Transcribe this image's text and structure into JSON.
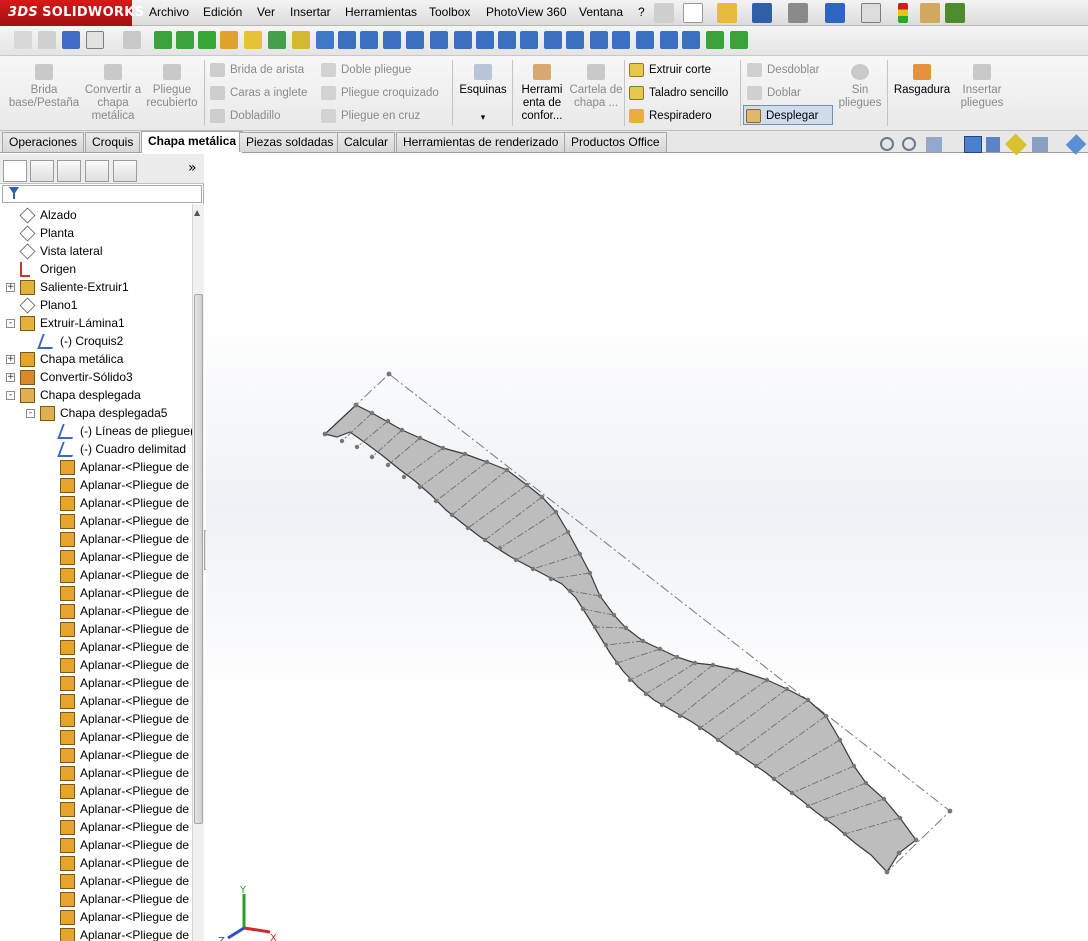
{
  "app": {
    "brand_prefix": "3DS",
    "brand": "SOLIDWORKS"
  },
  "menu": [
    "Archivo",
    "Edición",
    "Ver",
    "Insertar",
    "Herramientas",
    "Toolbox",
    "PhotoView 360",
    "Ventana",
    "?"
  ],
  "command_manager": {
    "brida_base": "Brida base/Pestaña",
    "convertir_chapa": "Convertir a chapa metálica",
    "pliegue_recubierto": "Pliegue recubierto",
    "brida_arista": "Brida de arista",
    "caras_inglete": "Caras a inglete",
    "dobladillo": "Dobladillo",
    "doble_pliegue": "Doble pliegue",
    "pliegue_croquizado": "Pliegue croquizado",
    "pliegue_cruz": "Pliegue en cruz",
    "esquinas": "Esquinas",
    "herramienta_conformar": "Herrami enta de confor...",
    "cartela": "Cartela de chapa ...",
    "extruir_corte": "Extruir corte",
    "taladro_sencillo": "Taladro sencillo",
    "respiradero": "Respiradero",
    "desdoblar": "Desdoblar",
    "doblar": "Doblar",
    "desplegar": "Desplegar",
    "sin_pliegues": "Sin pliegues",
    "rasgadura": "Rasgadura",
    "insertar_pliegues": "Insertar pliegues"
  },
  "tabs": [
    "Operaciones",
    "Croquis",
    "Chapa metálica",
    "Piezas soldadas",
    "Calcular",
    "Herramientas de renderizado",
    "Productos Office"
  ],
  "active_tab": "Chapa metálica",
  "panel": {
    "more_glyph": "»"
  },
  "tree": [
    {
      "label": "Alzado",
      "type": "plane",
      "level": 1
    },
    {
      "label": "Planta",
      "type": "plane",
      "level": 1
    },
    {
      "label": "Vista lateral",
      "type": "plane",
      "level": 1
    },
    {
      "label": "Origen",
      "type": "origin",
      "level": 1
    },
    {
      "label": "Saliente-Extruir1",
      "type": "feature",
      "level": 1,
      "expand": "+"
    },
    {
      "label": "Plano1",
      "type": "plane",
      "level": 1
    },
    {
      "label": "Extruir-Lámina1",
      "type": "feature",
      "level": 1,
      "expand": "-"
    },
    {
      "label": "(-) Croquis2",
      "type": "sketch",
      "level": 2
    },
    {
      "label": "Chapa metálica",
      "type": "sheet",
      "level": 1,
      "expand": "+"
    },
    {
      "label": "Convertir-Sólido3",
      "type": "convert",
      "level": 1,
      "expand": "+"
    },
    {
      "label": "Chapa desplegada",
      "type": "flat",
      "level": 1,
      "expand": "-"
    },
    {
      "label": "Chapa desplegada5",
      "type": "flat",
      "level": 2,
      "expand": "-"
    },
    {
      "label": "(-) Líneas de pliegue(",
      "type": "sketch",
      "level": 3
    },
    {
      "label": "(-) Cuadro delimitad",
      "type": "sketch",
      "level": 3
    },
    {
      "label": "Aplanar-<Pliegue de",
      "type": "flatten",
      "level": 3
    },
    {
      "label": "Aplanar-<Pliegue de",
      "type": "flatten",
      "level": 3
    },
    {
      "label": "Aplanar-<Pliegue de",
      "type": "flatten",
      "level": 3
    },
    {
      "label": "Aplanar-<Pliegue de",
      "type": "flatten",
      "level": 3
    },
    {
      "label": "Aplanar-<Pliegue de",
      "type": "flatten",
      "level": 3
    },
    {
      "label": "Aplanar-<Pliegue de",
      "type": "flatten",
      "level": 3
    },
    {
      "label": "Aplanar-<Pliegue de",
      "type": "flatten",
      "level": 3
    },
    {
      "label": "Aplanar-<Pliegue de",
      "type": "flatten",
      "level": 3
    },
    {
      "label": "Aplanar-<Pliegue de",
      "type": "flatten",
      "level": 3
    },
    {
      "label": "Aplanar-<Pliegue de",
      "type": "flatten",
      "level": 3
    },
    {
      "label": "Aplanar-<Pliegue de",
      "type": "flatten",
      "level": 3
    },
    {
      "label": "Aplanar-<Pliegue de",
      "type": "flatten",
      "level": 3
    },
    {
      "label": "Aplanar-<Pliegue de",
      "type": "flatten",
      "level": 3
    },
    {
      "label": "Aplanar-<Pliegue de",
      "type": "flatten",
      "level": 3
    },
    {
      "label": "Aplanar-<Pliegue de",
      "type": "flatten",
      "level": 3
    },
    {
      "label": "Aplanar-<Pliegue de",
      "type": "flatten",
      "level": 3
    },
    {
      "label": "Aplanar-<Pliegue de",
      "type": "flatten",
      "level": 3
    },
    {
      "label": "Aplanar-<Pliegue de",
      "type": "flatten",
      "level": 3
    },
    {
      "label": "Aplanar-<Pliegue de",
      "type": "flatten",
      "level": 3
    },
    {
      "label": "Aplanar-<Pliegue de",
      "type": "flatten",
      "level": 3
    },
    {
      "label": "Aplanar-<Pliegue de",
      "type": "flatten",
      "level": 3
    },
    {
      "label": "Aplanar-<Pliegue de",
      "type": "flatten",
      "level": 3
    },
    {
      "label": "Aplanar-<Pliegue de",
      "type": "flatten",
      "level": 3
    },
    {
      "label": "Aplanar-<Pliegue de",
      "type": "flatten",
      "level": 3
    },
    {
      "label": "Aplanar-<Pliegue de",
      "type": "flatten",
      "level": 3
    },
    {
      "label": "Aplanar-<Pliegue de",
      "type": "flatten",
      "level": 3
    },
    {
      "label": "Aplanar-<Pliegue de",
      "type": "flatten",
      "level": 3
    },
    {
      "label": "Aplanar-<Pliegue de",
      "type": "flatten",
      "level": 3
    },
    {
      "label": "Aplanar-<Pliegue de",
      "type": "flatten",
      "level": 3
    }
  ],
  "triad": {
    "x": "X",
    "y": "Y",
    "z": "Z"
  },
  "colors": {
    "part_fill": "#bdbdbd",
    "part_edge": "#3a3a3a",
    "bend_line": "#6a6a6a",
    "brand_red": "#c8161d",
    "selection": "#cfdcec"
  }
}
